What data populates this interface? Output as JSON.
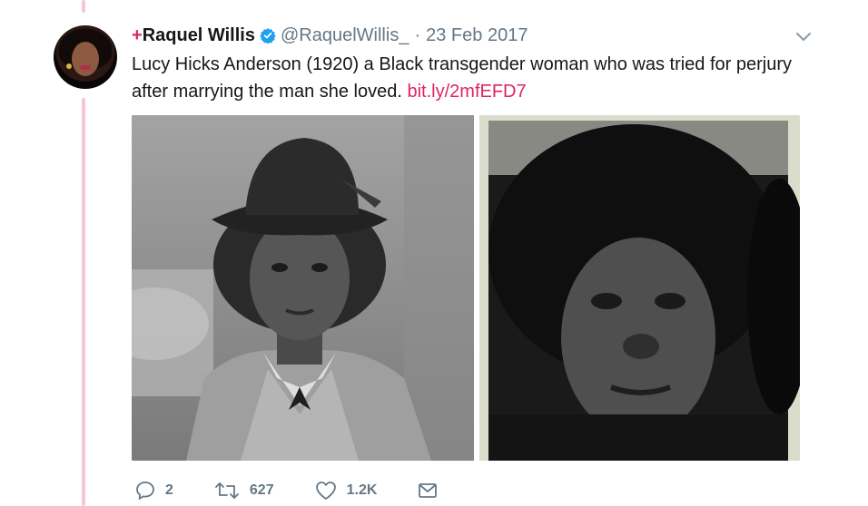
{
  "tweet": {
    "author_prefix": "+",
    "author_name": "Raquel Willis",
    "handle": "@RaquelWillis_",
    "separator": "·",
    "date": "23 Feb 2017",
    "text": "Lucy Hicks Anderson (1920) a Black transgender woman who was tried for perjury after marrying the man she loved.",
    "link": "bit.ly/2mfEFD7"
  },
  "actions": {
    "replies": "2",
    "retweets": "627",
    "likes": "1.2K"
  },
  "colors": {
    "accent": "#e0245e",
    "verified": "#1da1f2",
    "muted": "#657786",
    "thread_line": "#f7c6d4"
  },
  "icons": [
    "verified-badge-icon",
    "chevron-down-icon",
    "reply-icon",
    "retweet-icon",
    "like-icon",
    "direct-message-icon"
  ]
}
